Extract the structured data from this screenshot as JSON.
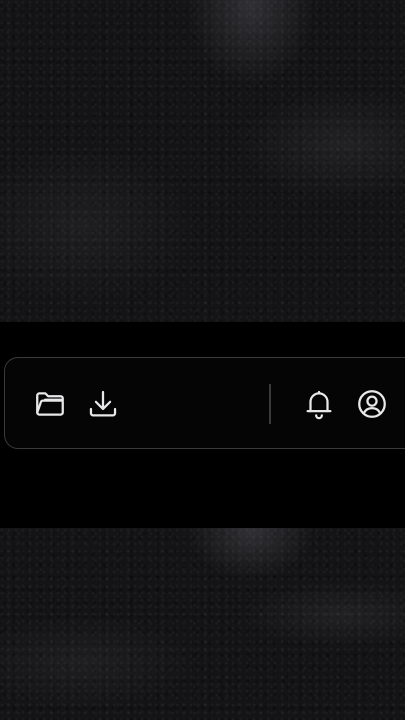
{
  "toolbar": {
    "buttons": [
      {
        "id": "folder",
        "icon": "folder-icon"
      },
      {
        "id": "download",
        "icon": "download-icon"
      },
      {
        "id": "notifications",
        "icon": "bell-icon"
      },
      {
        "id": "account",
        "icon": "user-circle-icon"
      }
    ]
  },
  "colors": {
    "toolbar_border": "#3a3a3d",
    "icon_stroke": "#e8e8ea",
    "band_background": "#000000"
  }
}
